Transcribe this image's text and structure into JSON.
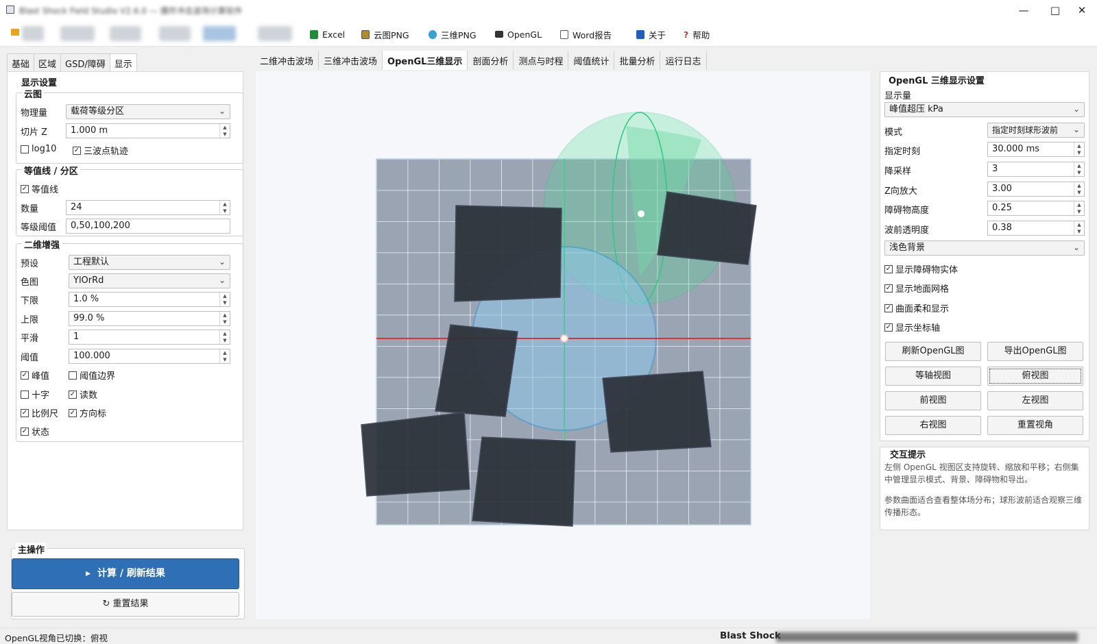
{
  "window": {
    "title": "Blast Shock Field Studio V2.6.0 — 爆炸冲击波场计算软件",
    "minimize_glyph": "—",
    "maximize_glyph": "□",
    "close_glyph": "✕"
  },
  "toolbar": {
    "items": [
      {
        "label": "Excel",
        "icon": "excel-icon"
      },
      {
        "label": "云图PNG",
        "icon": "image-icon"
      },
      {
        "label": "三维PNG",
        "icon": "globe-icon"
      },
      {
        "label": "OpenGL",
        "icon": "opengl-icon"
      },
      {
        "label": "Word报告",
        "icon": "document-icon"
      },
      {
        "label": "关于",
        "icon": "info-icon"
      },
      {
        "label": "帮助",
        "icon": "help-icon"
      }
    ]
  },
  "left_tabs": [
    "基础",
    "区域",
    "GSD/障碍",
    "显示"
  ],
  "display_settings": {
    "title": "显示设置",
    "cloud": {
      "title": "云图",
      "quantity_label": "物理量",
      "quantity_value": "载荷等级分区",
      "slice_label": "切片 Z",
      "slice_value": "1.000 m",
      "log10_label": "log10",
      "triple_label": "三波点轨迹"
    },
    "contour": {
      "title": "等值线 / 分区",
      "enable_label": "等值线",
      "count_label": "数量",
      "count_value": "24",
      "levels_label": "等级阈值",
      "levels_value": "0,50,100,200"
    },
    "enhance": {
      "title": "二维增强",
      "preset_label": "预设",
      "preset_value": "工程默认",
      "colormap_label": "色图",
      "colormap_value": "YlOrRd",
      "lower_label": "下限",
      "lower_value": "1.0 %",
      "upper_label": "上限",
      "upper_value": "99.0 %",
      "smooth_label": "平滑",
      "smooth_value": "1",
      "threshold_label": "阈值",
      "threshold_value": "100.000",
      "checks": [
        {
          "label": "峰值",
          "checked": true
        },
        {
          "label": "阈值边界",
          "checked": false
        },
        {
          "label": "十字",
          "checked": false
        },
        {
          "label": "读数",
          "checked": true
        },
        {
          "label": "比例尺",
          "checked": true
        },
        {
          "label": "方向标",
          "checked": true
        },
        {
          "label": "状态",
          "checked": true
        }
      ]
    }
  },
  "main_ops": {
    "title": "主操作",
    "compute_label": "计算 / 刷新结果",
    "compute_glyph": "▸",
    "reset_label": "重置结果",
    "reset_glyph": "↻"
  },
  "center_tabs": [
    "二维冲击波场",
    "三维冲击波场",
    "OpenGL三维显示",
    "剖面分析",
    "测点与时程",
    "阈值统计",
    "批量分析",
    "运行日志"
  ],
  "opengl_settings": {
    "title": "OpenGL 三维显示设置",
    "quantity_label": "显示量",
    "quantity_value": "峰值超压 kPa",
    "mode_label": "模式",
    "mode_value": "指定时刻球形波前",
    "time_label": "指定时刻",
    "time_value": "30.000 ms",
    "downsample_label": "降采样",
    "downsample_value": "3",
    "zscale_label": "Z向放大",
    "zscale_value": "3.00",
    "obstacle_h_label": "障碍物高度",
    "obstacle_h_value": "0.25",
    "front_alpha_label": "波前透明度",
    "front_alpha_value": "0.38",
    "background_value": "浅色背景",
    "checks": [
      {
        "label": "显示障碍物实体",
        "checked": true
      },
      {
        "label": "显示地面网格",
        "checked": true
      },
      {
        "label": "曲面柔和显示",
        "checked": true
      },
      {
        "label": "显示坐标轴",
        "checked": true
      }
    ],
    "buttons": [
      "刷新OpenGL图",
      "导出OpenGL图",
      "等轴视图",
      "俯视图",
      "前视图",
      "左视图",
      "右视图",
      "重置视角"
    ]
  },
  "hint": {
    "title": "交互提示",
    "line1": "左侧 OpenGL 视图区支持旋转、缩放和平移；右侧集中管理显示模式、背景、障碍物和导出。",
    "line2": "参数曲面适合查看整体场分布；球形波前适合观察三维传播形态。"
  },
  "status": {
    "left": "OpenGL视角已切换：俯视",
    "right": "Blast Shock"
  },
  "colors": {
    "primary": "#2f6fb5",
    "grid_bg": "#9aa4b3",
    "obstacle": "#2b3038",
    "wave_blue": "#3aa0d8",
    "wave_green": "#2ecc80",
    "axis_red": "#e03030"
  }
}
